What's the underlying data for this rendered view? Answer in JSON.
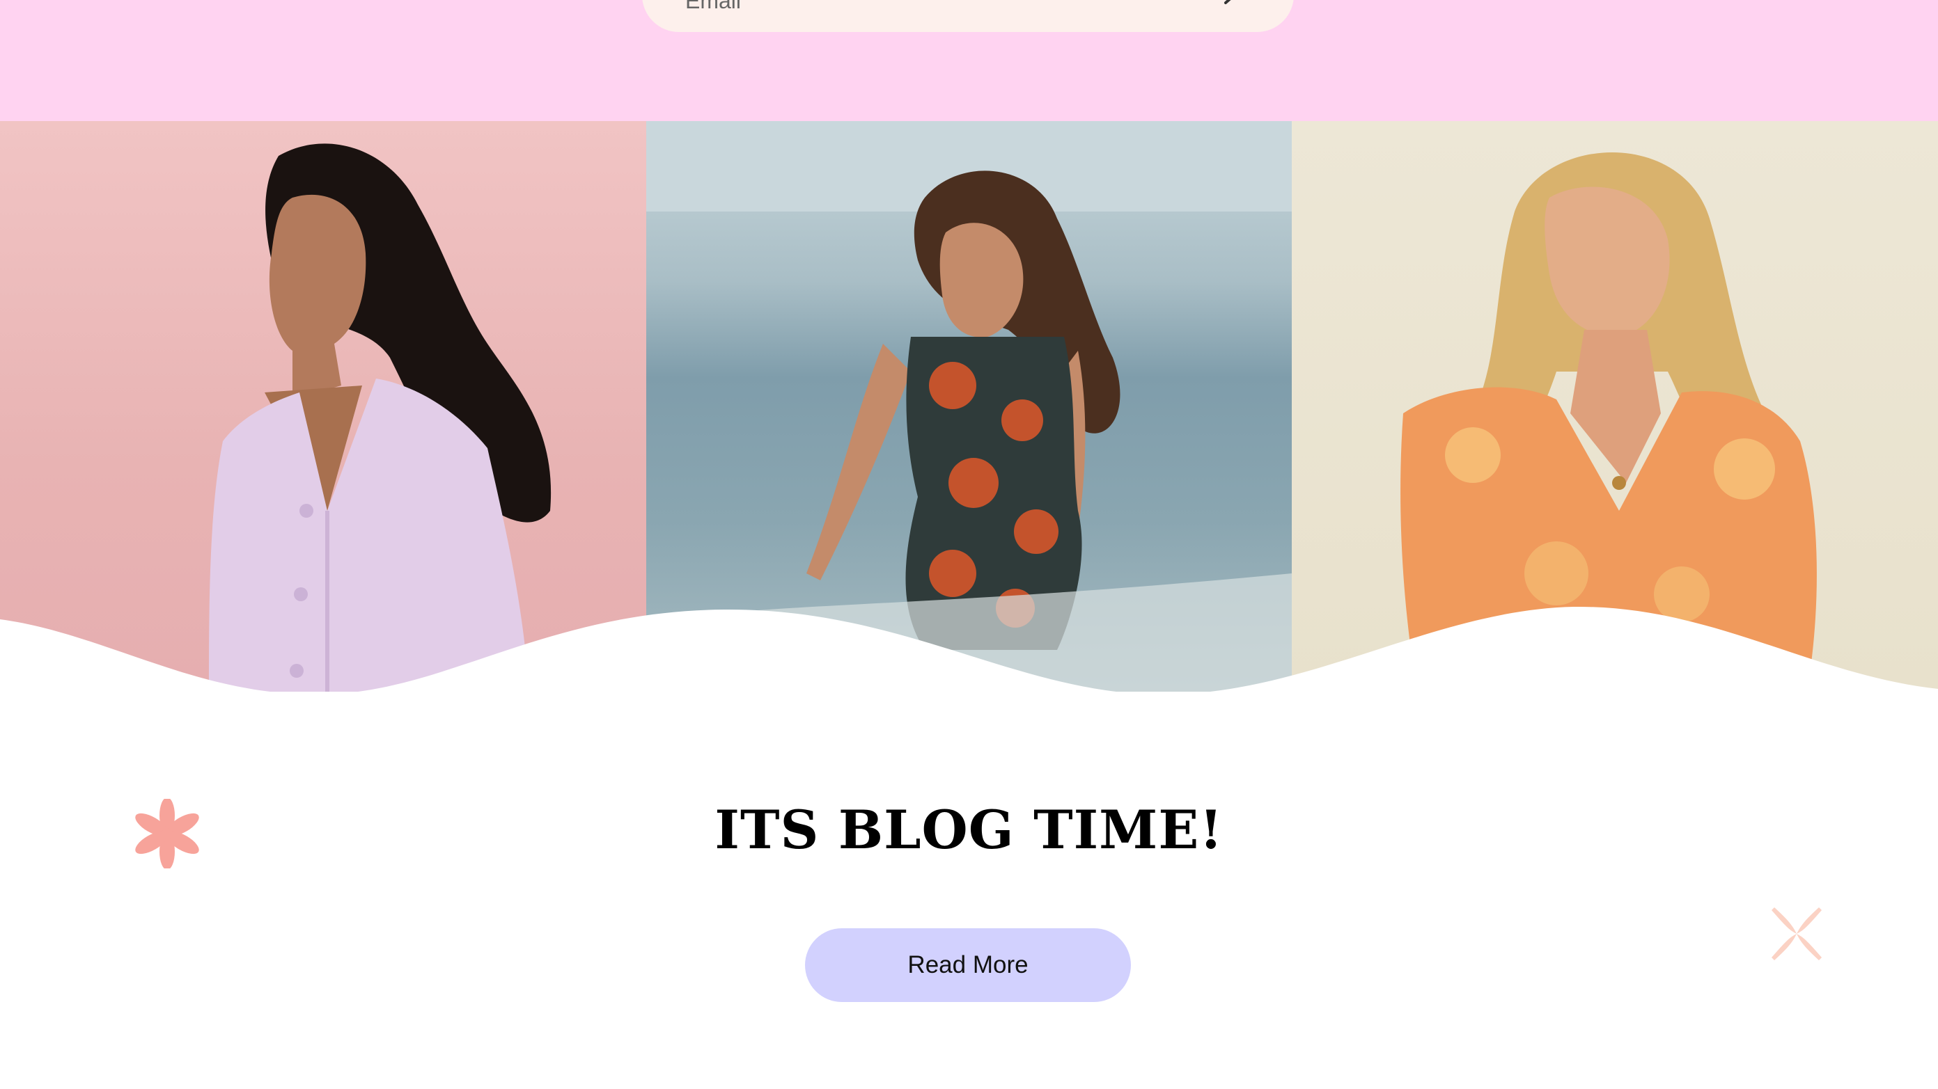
{
  "newsletter": {
    "email_placeholder": "Email",
    "submit_icon": "chevron-right-icon"
  },
  "gallery": {
    "photos": [
      {
        "alt": "Woman in lilac cardigan"
      },
      {
        "alt": "Woman in floral romper on beach"
      },
      {
        "alt": "Woman in orange floral dress"
      }
    ]
  },
  "blog": {
    "title": "ITS BLOG TIME!",
    "button_label": "Read More"
  },
  "decorations": {
    "flower_icon": "flower-icon",
    "sparkle_icon": "x-sparkle-icon"
  },
  "colors": {
    "top_band": "#ffd3f1",
    "email_pill": "#fdf0ec",
    "button": "#d2d1fe",
    "accent_coral": "#f7a39a"
  }
}
